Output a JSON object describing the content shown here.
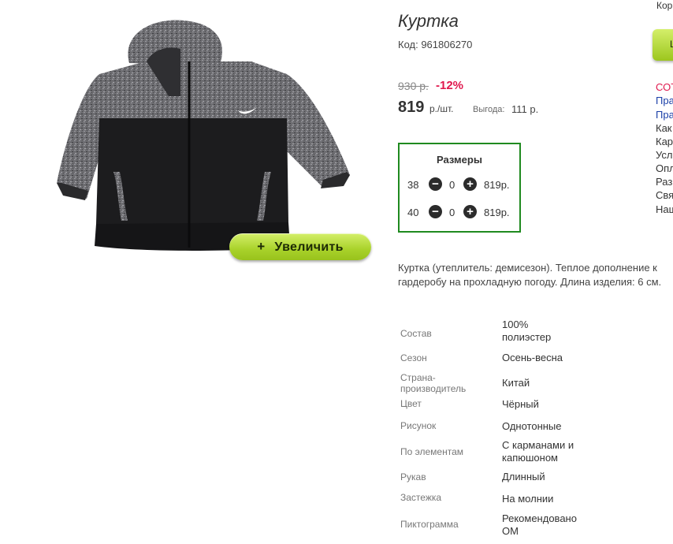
{
  "product": {
    "title": "Куртка",
    "code": "Код: 961806270",
    "old_price": "930 р.",
    "discount": "-12%",
    "price": "819",
    "price_unit": "р./шт.",
    "benefit_label": "Выгода:",
    "benefit_value": "111 р.",
    "zoom_label": "Увеличить",
    "zoom_icon": "plus-icon"
  },
  "sizes": {
    "title": "Размеры",
    "rows": [
      {
        "size": "38",
        "qty": "0",
        "price": "819р."
      },
      {
        "size": "40",
        "qty": "0",
        "price": "819р."
      }
    ]
  },
  "description": "Куртка (утеплитель: демисезон). Теплое дополнение к гардеробу на прохладную погоду. Длина изделия: 6 см.",
  "attributes": [
    {
      "label": "Состав",
      "value": "100% полиэстер"
    },
    {
      "label": "Сезон",
      "value": "Осень-весна"
    },
    {
      "label": "Страна-производитель",
      "value": "Китай"
    },
    {
      "label": "Цвет",
      "value": "Чёрный"
    },
    {
      "label": "Рисунок",
      "value": "Однотонные"
    },
    {
      "label": "По элементам",
      "value": "С карманами и капюшоном"
    },
    {
      "label": "Рукав",
      "value": "Длинный"
    },
    {
      "label": "Застежка",
      "value": "На молнии"
    },
    {
      "label": "Пиктограмма",
      "value": "Рекомендовано ОМ"
    }
  ],
  "sidebar": {
    "top_text": "Кор",
    "button_text": "L",
    "links": [
      {
        "text": "СОТ",
        "color": "#e0184d"
      },
      {
        "text": "Пра",
        "color": "#1a3fa8"
      },
      {
        "text": "Пра",
        "color": "#1a3fa8"
      },
      {
        "text": "Как",
        "color": "#333333"
      },
      {
        "text": "Кар",
        "color": "#333333"
      },
      {
        "text": "Усл",
        "color": "#333333"
      },
      {
        "text": "Опл",
        "color": "#333333"
      },
      {
        "text": "Раз",
        "color": "#333333"
      },
      {
        "text": "Свя",
        "color": "#333333"
      },
      {
        "text": "Наш",
        "color": "#333333"
      }
    ]
  },
  "colors": {
    "discount": "#e0184d",
    "sizes_border": "#1f8a1f",
    "zoom_button": "#a9d22a"
  }
}
